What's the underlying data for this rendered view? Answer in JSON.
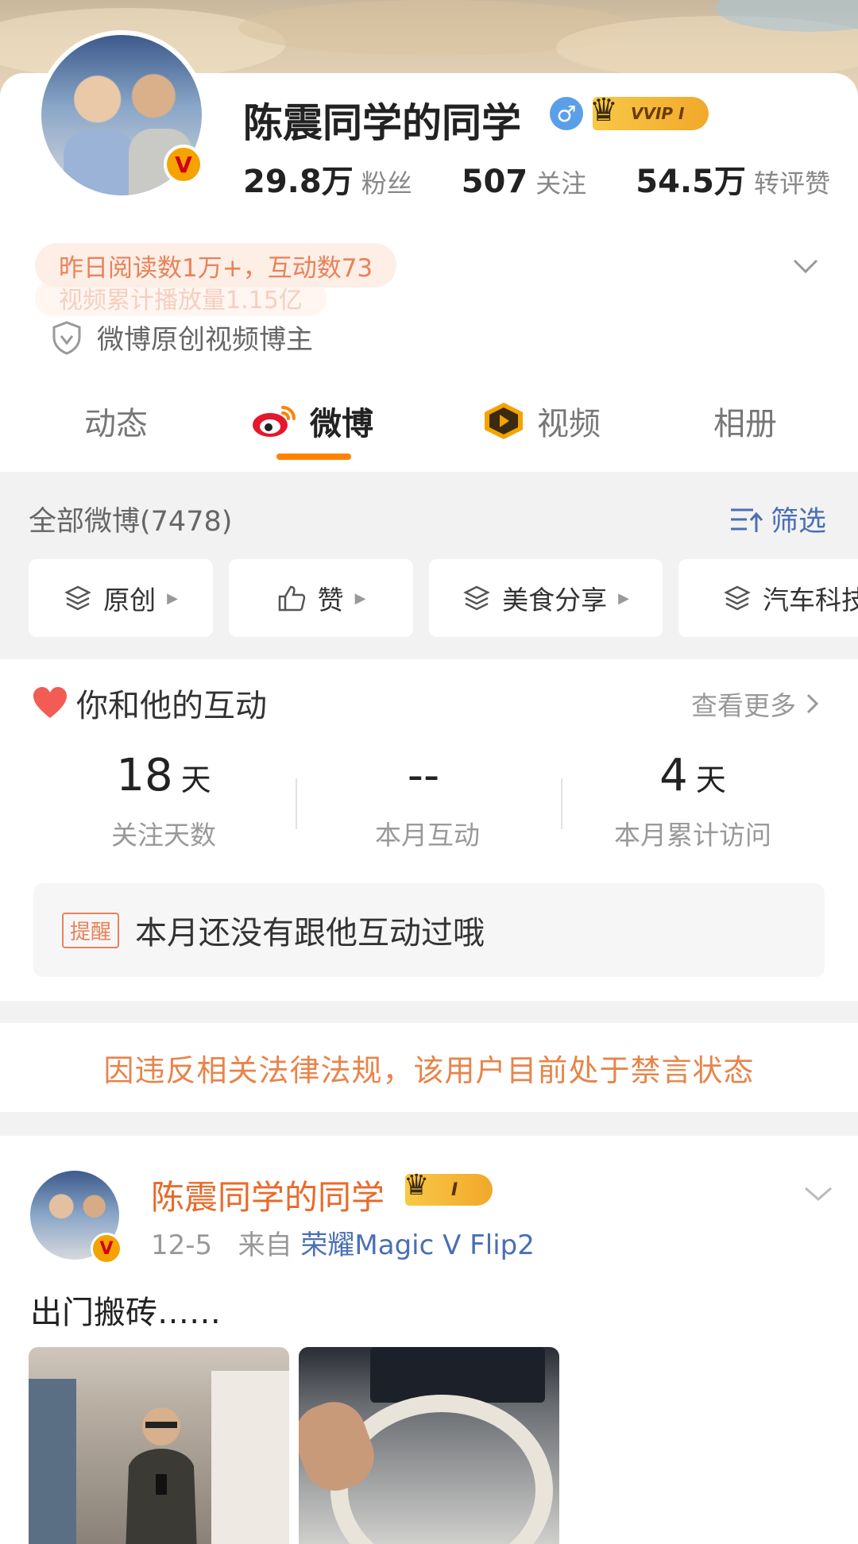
{
  "profile": {
    "username": "陈震同学的同学",
    "vip_label": "VVIP I",
    "stats": [
      {
        "num": "29.8万",
        "label": "粉丝"
      },
      {
        "num": "507",
        "label": "关注"
      },
      {
        "num": "54.5万",
        "label": "转评赞"
      }
    ],
    "read_stats": "昨日阅读数1万+，互动数73",
    "video_stats": "视频累计播放量1.15亿",
    "certification": "微博原创视频博主"
  },
  "tabs": [
    {
      "label": "动态"
    },
    {
      "label": "微博"
    },
    {
      "label": "视频"
    },
    {
      "label": "相册"
    }
  ],
  "feed_header": {
    "all_label": "全部微博(7478)",
    "filter_label": "筛选"
  },
  "chips": [
    {
      "label": "原创"
    },
    {
      "label": "赞"
    },
    {
      "label": "美食分享"
    },
    {
      "label": "汽车科技"
    }
  ],
  "interaction": {
    "title": "你和他的互动",
    "more": "查看更多",
    "stats": [
      {
        "value": "18",
        "unit": "天",
        "label": "关注天数"
      },
      {
        "value": "--",
        "unit": "",
        "label": "本月互动"
      },
      {
        "value": "4",
        "unit": "天",
        "label": "本月累计访问"
      }
    ],
    "remind_tag": "提醒",
    "remind_text": "本月还没有跟他互动过哦"
  },
  "ban_notice": "因违反相关法律法规，该用户目前处于禁言状态",
  "post": {
    "author": "陈震同学的同学",
    "vip_label": "I",
    "date": "12-5",
    "from_label": "来自",
    "source": "荣耀Magic V Flip2",
    "text": "出门搬砖……"
  },
  "colors": {
    "accent": "#ff8200",
    "link_blue": "#4a6fb4",
    "notice_orange": "#e8844a",
    "section_gray": "#f2f2f2"
  }
}
